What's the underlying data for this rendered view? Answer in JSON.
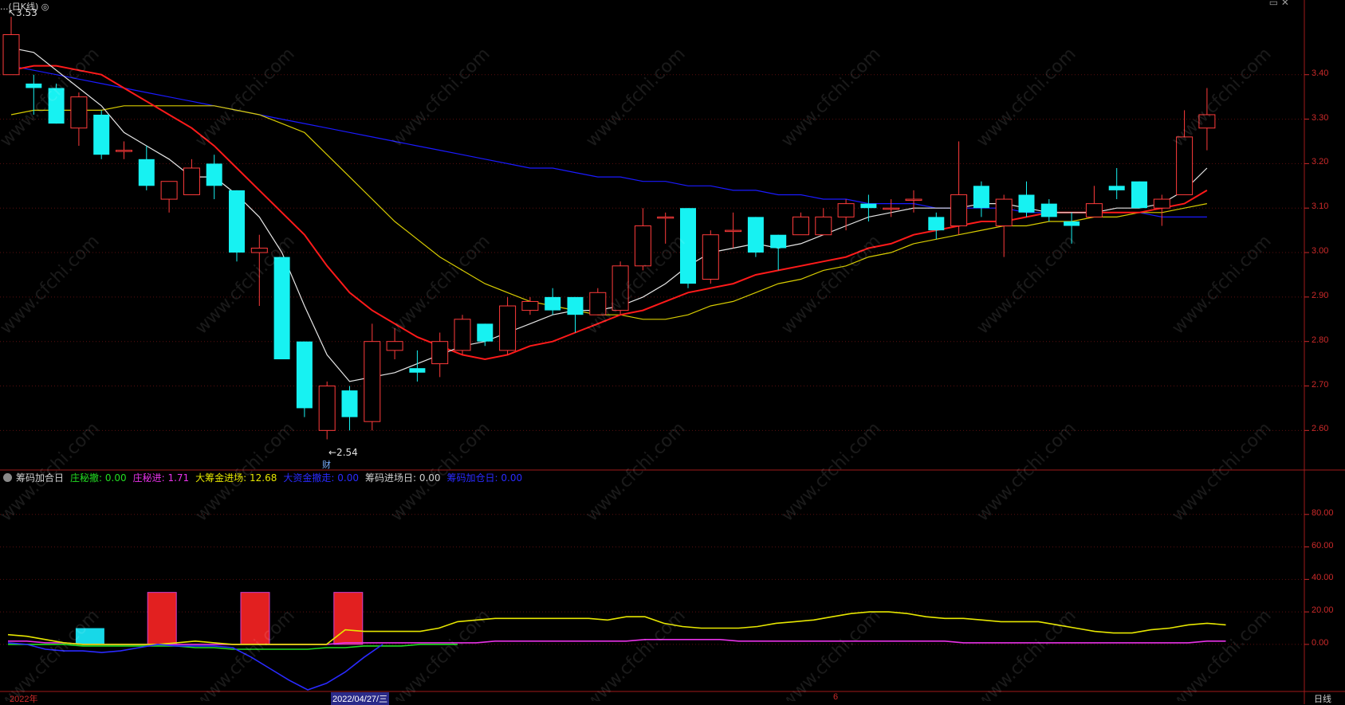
{
  "header": {
    "title_fragment": "...(日K线) ◎",
    "window_controls": "▭ ✕"
  },
  "main_chart": {
    "price_axis": [
      "3.40",
      "3.30",
      "3.20",
      "3.10",
      "3.00",
      "2.90",
      "2.80",
      "2.70",
      "2.60"
    ],
    "high_marker": "3.53",
    "low_marker": "2.54",
    "finance_badge": "财",
    "colors": {
      "up": "#ff3b3b",
      "down": "#17f2f2",
      "ma5": "#e6e6e6",
      "ma10": "#ff1a1a",
      "ma20": "#d8cc00",
      "ma60": "#1a1aff"
    }
  },
  "indicator": {
    "name": "筹码加合日",
    "items": [
      {
        "label": "庄秘撤: 0.00",
        "color": "#22dd22"
      },
      {
        "label": "庄秘进: 1.71",
        "color": "#e832e8"
      },
      {
        "label": "大筹金进场: 12.68",
        "color": "#e6e600"
      },
      {
        "label": "大资金撤走: 0.00",
        "color": "#2a2aff"
      },
      {
        "label": "筹码进场日: 0.00",
        "color": "#cfcfcf"
      },
      {
        "label": "筹码加仓日: 0.00",
        "color": "#2a2aff"
      }
    ],
    "axis": [
      "80.00",
      "60.00",
      "40.00",
      "20.00",
      "0.00"
    ]
  },
  "date_axis": {
    "labels": [
      "2022年",
      "2022/04/27/三",
      "6"
    ]
  },
  "period_label": "日线",
  "watermark_text": "www.cfchi.com",
  "chart_data": {
    "type": "candlestick",
    "candles": [
      [
        3.4,
        3.49,
        3.53,
        3.4
      ],
      [
        3.38,
        3.37,
        3.4,
        3.31
      ],
      [
        3.37,
        3.29,
        3.38,
        3.29
      ],
      [
        3.28,
        3.35,
        3.36,
        3.24
      ],
      [
        3.31,
        3.22,
        3.32,
        3.21
      ],
      [
        3.23,
        3.23,
        3.25,
        3.21
      ],
      [
        3.21,
        3.15,
        3.24,
        3.14
      ],
      [
        3.12,
        3.16,
        3.16,
        3.09
      ],
      [
        3.13,
        3.19,
        3.21,
        3.13
      ],
      [
        3.2,
        3.15,
        3.22,
        3.12
      ],
      [
        3.14,
        3.0,
        3.14,
        2.98
      ],
      [
        3.0,
        3.01,
        3.04,
        2.88
      ],
      [
        2.99,
        2.76,
        2.99,
        2.76
      ],
      [
        2.8,
        2.65,
        2.8,
        2.63
      ],
      [
        2.6,
        2.7,
        2.71,
        2.58
      ],
      [
        2.69,
        2.63,
        2.7,
        2.6
      ],
      [
        2.62,
        2.8,
        2.84,
        2.6
      ],
      [
        2.78,
        2.8,
        2.83,
        2.76
      ],
      [
        2.74,
        2.73,
        2.78,
        2.71
      ],
      [
        2.75,
        2.8,
        2.82,
        2.72
      ],
      [
        2.78,
        2.85,
        2.86,
        2.77
      ],
      [
        2.84,
        2.8,
        2.84,
        2.79
      ],
      [
        2.78,
        2.88,
        2.9,
        2.77
      ],
      [
        2.87,
        2.89,
        2.9,
        2.86
      ],
      [
        2.9,
        2.87,
        2.92,
        2.86
      ],
      [
        2.9,
        2.86,
        2.9,
        2.82
      ],
      [
        2.86,
        2.91,
        2.92,
        2.86
      ],
      [
        2.87,
        2.97,
        2.98,
        2.86
      ],
      [
        2.97,
        3.06,
        3.1,
        2.96
      ],
      [
        3.08,
        3.08,
        3.09,
        3.02
      ],
      [
        3.1,
        2.93,
        3.1,
        2.92
      ],
      [
        2.94,
        3.04,
        3.05,
        2.93
      ],
      [
        3.05,
        3.05,
        3.09,
        3.01
      ],
      [
        3.08,
        3.0,
        3.08,
        2.99
      ],
      [
        3.04,
        3.01,
        3.04,
        2.96
      ],
      [
        3.04,
        3.08,
        3.09,
        3.04
      ],
      [
        3.04,
        3.08,
        3.1,
        3.04
      ],
      [
        3.08,
        3.11,
        3.12,
        3.05
      ],
      [
        3.11,
        3.1,
        3.13,
        3.07
      ],
      [
        3.1,
        3.1,
        3.12,
        3.08
      ],
      [
        3.12,
        3.12,
        3.14,
        3.09
      ],
      [
        3.08,
        3.05,
        3.09,
        3.03
      ],
      [
        3.06,
        3.13,
        3.25,
        3.04
      ],
      [
        3.15,
        3.1,
        3.16,
        3.08
      ],
      [
        3.06,
        3.12,
        3.13,
        2.99
      ],
      [
        3.13,
        3.09,
        3.16,
        3.08
      ],
      [
        3.11,
        3.08,
        3.12,
        3.07
      ],
      [
        3.07,
        3.06,
        3.09,
        3.02
      ],
      [
        3.08,
        3.11,
        3.15,
        3.08
      ],
      [
        3.15,
        3.14,
        3.19,
        3.12
      ],
      [
        3.16,
        3.1,
        3.16,
        3.1
      ],
      [
        3.1,
        3.12,
        3.13,
        3.06
      ],
      [
        3.13,
        3.26,
        3.32,
        3.13
      ],
      [
        3.28,
        3.31,
        3.37,
        3.23
      ]
    ],
    "ma5": [
      3.46,
      3.45,
      3.41,
      3.37,
      3.33,
      3.27,
      3.24,
      3.21,
      3.17,
      3.17,
      3.13,
      3.08,
      3.0,
      2.88,
      2.77,
      2.71,
      2.72,
      2.73,
      2.75,
      2.77,
      2.79,
      2.8,
      2.82,
      2.84,
      2.86,
      2.87,
      2.87,
      2.88,
      2.9,
      2.93,
      2.97,
      3.0,
      3.01,
      3.02,
      3.01,
      3.02,
      3.04,
      3.06,
      3.08,
      3.09,
      3.1,
      3.1,
      3.1,
      3.11,
      3.11,
      3.1,
      3.09,
      3.09,
      3.09,
      3.1,
      3.1,
      3.11,
      3.14,
      3.19
    ],
    "ma10": [
      3.41,
      3.42,
      3.42,
      3.41,
      3.4,
      3.37,
      3.34,
      3.31,
      3.28,
      3.24,
      3.19,
      3.14,
      3.09,
      3.04,
      2.97,
      2.91,
      2.87,
      2.84,
      2.81,
      2.79,
      2.77,
      2.76,
      2.77,
      2.79,
      2.8,
      2.82,
      2.84,
      2.86,
      2.87,
      2.89,
      2.91,
      2.92,
      2.93,
      2.95,
      2.96,
      2.97,
      2.98,
      2.99,
      3.01,
      3.02,
      3.04,
      3.05,
      3.06,
      3.07,
      3.07,
      3.08,
      3.09,
      3.09,
      3.09,
      3.09,
      3.09,
      3.1,
      3.11,
      3.14
    ],
    "ma20": [
      3.31,
      3.32,
      3.32,
      3.32,
      3.32,
      3.33,
      3.33,
      3.33,
      3.33,
      3.33,
      3.32,
      3.31,
      3.29,
      3.27,
      3.22,
      3.17,
      3.12,
      3.07,
      3.03,
      2.99,
      2.96,
      2.93,
      2.91,
      2.89,
      2.88,
      2.87,
      2.86,
      2.86,
      2.85,
      2.85,
      2.86,
      2.88,
      2.89,
      2.91,
      2.93,
      2.94,
      2.96,
      2.97,
      2.99,
      3.0,
      3.02,
      3.03,
      3.04,
      3.05,
      3.06,
      3.06,
      3.07,
      3.07,
      3.08,
      3.08,
      3.09,
      3.09,
      3.1,
      3.11
    ],
    "ma60": [
      3.42,
      3.41,
      3.4,
      3.39,
      3.38,
      3.37,
      3.36,
      3.35,
      3.34,
      3.33,
      3.32,
      3.31,
      3.3,
      3.29,
      3.28,
      3.27,
      3.26,
      3.25,
      3.24,
      3.23,
      3.22,
      3.21,
      3.2,
      3.19,
      3.19,
      3.18,
      3.17,
      3.17,
      3.16,
      3.16,
      3.15,
      3.15,
      3.14,
      3.14,
      3.13,
      3.13,
      3.12,
      3.12,
      3.11,
      3.11,
      3.11,
      3.1,
      3.1,
      3.1,
      3.1,
      3.09,
      3.09,
      3.09,
      3.09,
      3.09,
      3.09,
      3.08,
      3.08,
      3.08
    ],
    "ylim": [
      2.52,
      3.55
    ],
    "sub_yellow": [
      6,
      5,
      3,
      1,
      0,
      0,
      0,
      0,
      0,
      1,
      2,
      1,
      0,
      0,
      0,
      0,
      0,
      0,
      9,
      8,
      8,
      8,
      8,
      10,
      14,
      15,
      16,
      16,
      16,
      16,
      16,
      16,
      15,
      17,
      17,
      13,
      11,
      10,
      10,
      10,
      11,
      13,
      14,
      15,
      17,
      19,
      20,
      20,
      19,
      17,
      16,
      16,
      15,
      14,
      14,
      14,
      12,
      10,
      8,
      7,
      7,
      9,
      10,
      12,
      13,
      12
    ],
    "sub_magenta": [
      2,
      2,
      1,
      1,
      0,
      0,
      0,
      0,
      0,
      0,
      0,
      0,
      0,
      0,
      0,
      0,
      0,
      0,
      1,
      1,
      1,
      1,
      1,
      1,
      1,
      1,
      2,
      2,
      2,
      2,
      2,
      2,
      2,
      2,
      3,
      3,
      3,
      3,
      3,
      2,
      2,
      2,
      2,
      2,
      2,
      2,
      2,
      2,
      2,
      2,
      2,
      1,
      1,
      1,
      1,
      1,
      1,
      1,
      1,
      1,
      1,
      1,
      1,
      1,
      2,
      2
    ],
    "sub_green": [
      0,
      0,
      0,
      0,
      -1,
      -1,
      -1,
      -1,
      -1,
      -1,
      -2,
      -2,
      -3,
      -3,
      -3,
      -3,
      -3,
      -2,
      -2,
      -1,
      -1,
      -1,
      0,
      0,
      0
    ],
    "sub_blue": [
      1,
      0,
      -3,
      -4,
      -4,
      -5,
      -4,
      -2,
      0,
      -1,
      -1,
      -1,
      -2,
      -8,
      -15,
      -22,
      -28,
      -24,
      -17,
      -8,
      0
    ],
    "sub_bars_red": [
      6,
      10,
      14
    ],
    "sub_bar_cyan": 3,
    "sub_ylim": [
      -28,
      100
    ]
  }
}
